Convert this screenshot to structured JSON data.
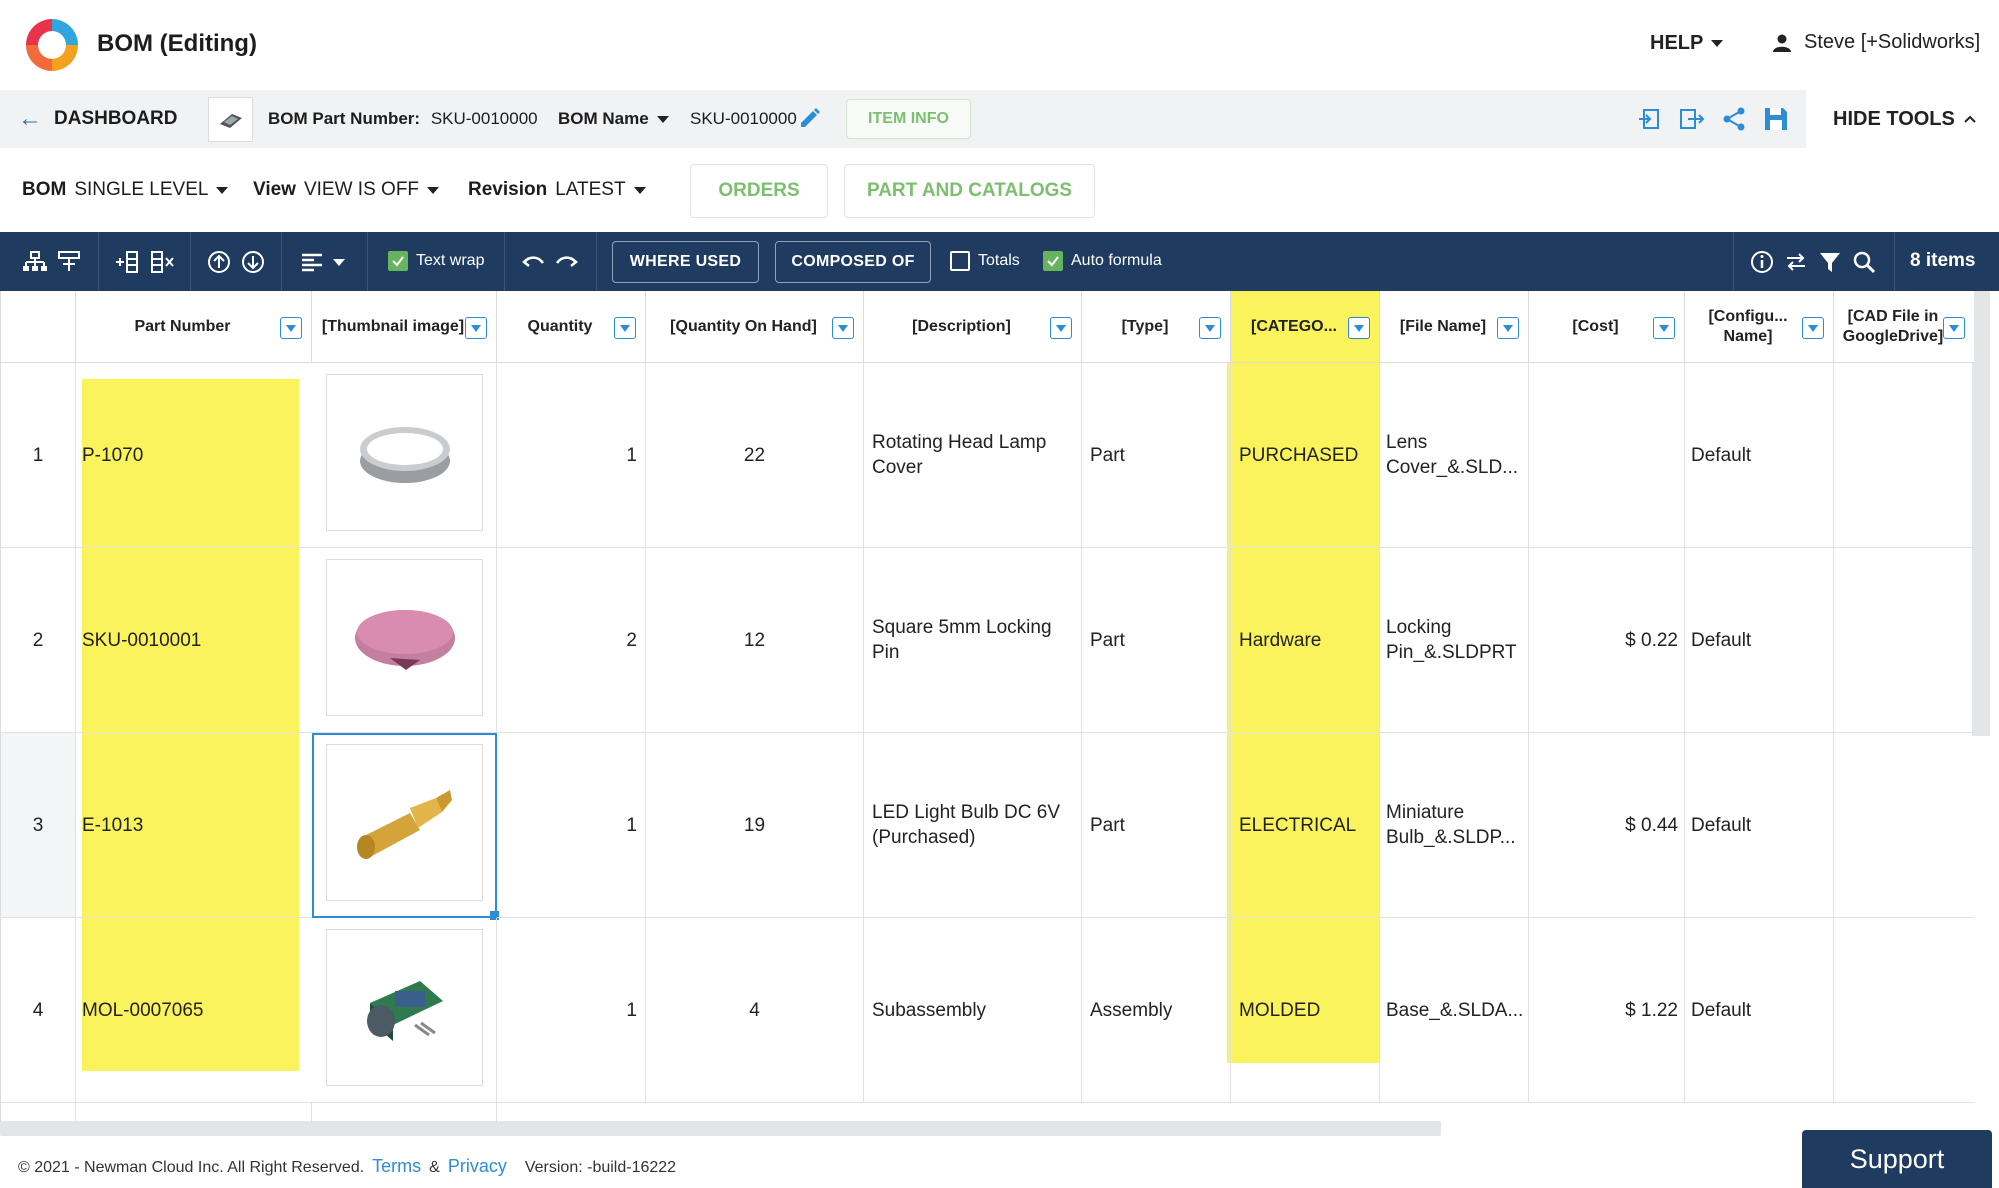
{
  "header": {
    "title": "BOM (Editing)",
    "help": "HELP",
    "user": "Steve [+Solidworks]"
  },
  "nav": {
    "dashboard": "DASHBOARD",
    "bom_part_number_label": "BOM Part Number:",
    "bom_part_number": "SKU-0010000",
    "bom_name_label": "BOM Name",
    "bom_name": "SKU-0010000",
    "item_info": "ITEM INFO",
    "hide_tools": "HIDE TOOLS"
  },
  "subbar": {
    "bom_label": "BOM",
    "bom_value": "SINGLE LEVEL",
    "view_label": "View",
    "view_value": "VIEW IS OFF",
    "revision_label": "Revision",
    "revision_value": "LATEST",
    "orders": "ORDERS",
    "parts_catalogs": "PART AND CATALOGS"
  },
  "toolbar": {
    "text_wrap": "Text wrap",
    "where_used": "WHERE USED",
    "composed_of": "COMPOSED OF",
    "totals": "Totals",
    "auto_formula": "Auto formula",
    "items_count": "8 items",
    "text_wrap_checked": true,
    "totals_checked": false,
    "auto_formula_checked": true
  },
  "columns": [
    "Part Number",
    "[Thumbnail image]",
    "Quantity",
    "[Quantity On Hand]",
    "[Description]",
    "[Type]",
    "[CATEGO...",
    "[File Name]",
    "[Cost]",
    "[Configu... Name]",
    "[CAD File in GoogleDrive]"
  ],
  "rows": [
    {
      "num": "1",
      "part": "P-1070",
      "thumb": "ring-icon",
      "qty": "1",
      "onhand": "22",
      "desc": "Rotating Head Lamp Cover",
      "type": "Part",
      "category": "PURCHASED",
      "file": "Lens Cover_&.SLD...",
      "cost": "",
      "config": "Default"
    },
    {
      "num": "2",
      "part": "SKU-0010001",
      "thumb": "disc-icon",
      "qty": "2",
      "onhand": "12",
      "desc": "Square 5mm Locking Pin",
      "type": "Part",
      "category": "Hardware",
      "file": "Locking Pin_&.SLDPRT",
      "cost": "$ 0.22",
      "config": "Default"
    },
    {
      "num": "3",
      "part": "E-1013",
      "thumb": "bulb-icon",
      "qty": "1",
      "onhand": "19",
      "desc": "LED Light Bulb DC 6V (Purchased)",
      "type": "Part",
      "category": "ELECTRICAL",
      "file": "Miniature Bulb_&.SLDP...",
      "cost": "$ 0.44",
      "config": "Default"
    },
    {
      "num": "4",
      "part": "MOL-0007065",
      "thumb": "assembly-icon",
      "qty": "1",
      "onhand": "4",
      "desc": "Subassembly",
      "type": "Assembly",
      "category": "MOLDED",
      "file": "Base_&.SLDA...",
      "cost": "$ 1.22",
      "config": "Default"
    }
  ],
  "footer": {
    "copyright": "© 2021 - Newman Cloud Inc. All Right Reserved.",
    "terms": "Terms",
    "amp": "&",
    "privacy": "Privacy",
    "version": "Version: -build-16222",
    "support": "Support"
  },
  "colors": {
    "toolbar_bg": "#1f3b5f",
    "highlight": "#fbf35c",
    "accent_green": "#7bbf6f",
    "link_blue": "#2d8cd6"
  }
}
